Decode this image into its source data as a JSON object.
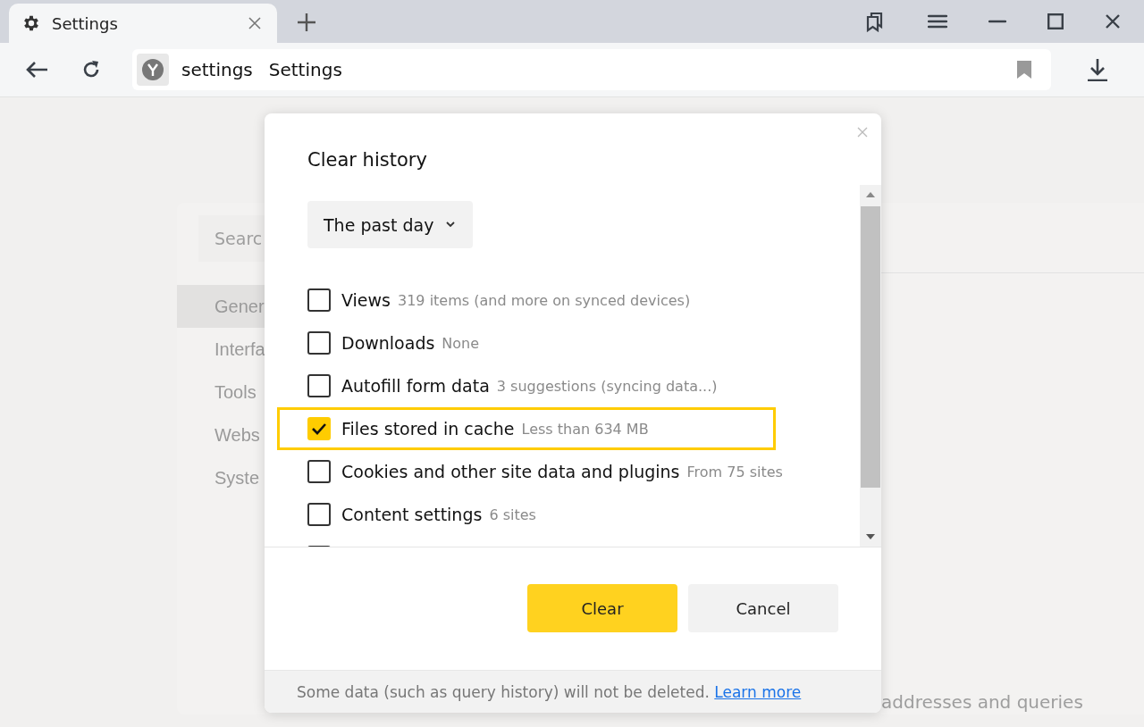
{
  "tabs": [
    {
      "title": "Settings",
      "selected": true
    }
  ],
  "address": {
    "host": "settings",
    "title": "Settings"
  },
  "background": {
    "search_placeholder": "Searc",
    "nav": [
      {
        "label": "Gener",
        "selected": true
      },
      {
        "label": "Interfa",
        "selected": false
      },
      {
        "label": "Tools",
        "selected": false
      },
      {
        "label": "Webs",
        "selected": false
      },
      {
        "label": "Syste",
        "selected": false
      }
    ],
    "text": "addresses and queries"
  },
  "dialog": {
    "title": "Clear history",
    "period": "The past day",
    "items": [
      {
        "label": "Views",
        "detail": "319 items (and more on synced devices)",
        "checked": false,
        "highlighted": false
      },
      {
        "label": "Downloads",
        "detail": "None",
        "checked": false,
        "highlighted": false
      },
      {
        "label": "Autofill form data",
        "detail": "3 suggestions (syncing data...)",
        "checked": false,
        "highlighted": false
      },
      {
        "label": "Files stored in cache",
        "detail": "Less than 634 MB",
        "checked": true,
        "highlighted": true
      },
      {
        "label": "Cookies and other site data and plugins",
        "detail": "From 75 sites",
        "checked": false,
        "highlighted": false
      },
      {
        "label": "Content settings",
        "detail": "6 sites",
        "checked": false,
        "highlighted": false
      },
      {
        "checked": false,
        "highlighted": false
      }
    ],
    "buttons": [
      {
        "label": "Clear",
        "kind": "primary"
      },
      {
        "label": "Cancel",
        "kind": "secondary"
      }
    ],
    "note": "Some data (such as query history) will not be deleted.",
    "link": "Learn more"
  }
}
